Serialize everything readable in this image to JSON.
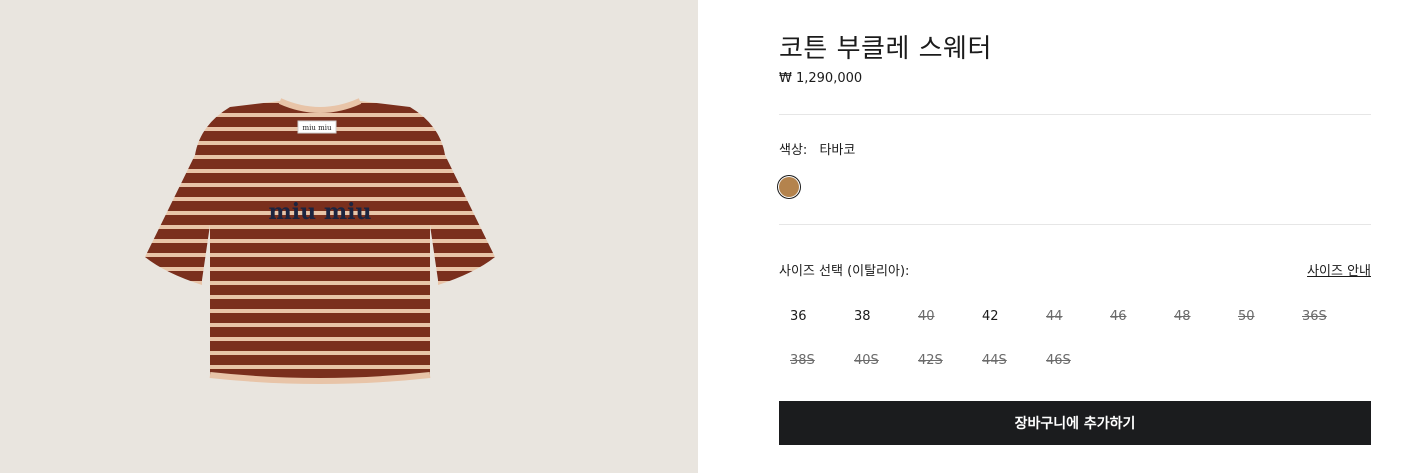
{
  "product": {
    "title": "코튼 부클레 스웨터",
    "price": "₩ 1,290,000",
    "image_alt": "striped cropped knit sweater",
    "logo_text": "miu miu"
  },
  "color": {
    "label": "색상:",
    "value": "타바코",
    "swatch_hex": "#b4834d"
  },
  "sizes": {
    "label": "사이즈 선택 (이탈리아):",
    "guide_link": "사이즈 안내",
    "options": [
      {
        "label": "36",
        "available": true
      },
      {
        "label": "38",
        "available": true
      },
      {
        "label": "40",
        "available": false
      },
      {
        "label": "42",
        "available": true
      },
      {
        "label": "44",
        "available": false
      },
      {
        "label": "46",
        "available": false
      },
      {
        "label": "48",
        "available": false
      },
      {
        "label": "50",
        "available": false
      },
      {
        "label": "36S",
        "available": false
      },
      {
        "label": "38S",
        "available": false
      },
      {
        "label": "40S",
        "available": false
      },
      {
        "label": "42S",
        "available": false
      },
      {
        "label": "44S",
        "available": false
      },
      {
        "label": "46S",
        "available": false
      }
    ]
  },
  "cart": {
    "button_label": "장바구니에 추가하기"
  },
  "colors": {
    "sweater_base": "#7a2f1d",
    "sweater_stripe": "#e8c4a8",
    "background": "#e9e5df",
    "button_bg": "#1b1c1e"
  }
}
